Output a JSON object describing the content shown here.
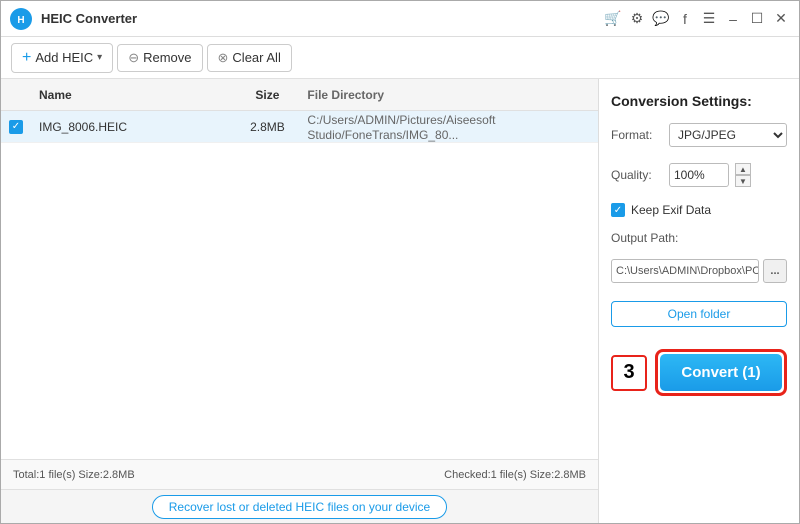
{
  "titlebar": {
    "title": "HEIC Converter",
    "min_label": "–",
    "max_label": "☐",
    "close_label": "✕",
    "icons": [
      "🛒",
      "⚙",
      "💬",
      "f",
      "☰"
    ]
  },
  "toolbar": {
    "add_label": "Add HEIC",
    "remove_label": "Remove",
    "clear_label": "Clear All"
  },
  "table": {
    "col_check": "",
    "col_name": "Name",
    "col_size": "Size",
    "col_dir": "File Directory",
    "rows": [
      {
        "name": "IMG_8006.HEIC",
        "size": "2.8MB",
        "dir": "C:/Users/ADMIN/Pictures/Aiseesoft Studio/FoneTrans/IMG_80..."
      }
    ]
  },
  "panel": {
    "title": "Conversion Settings:",
    "format_label": "Format:",
    "format_value": "JPG/JPEG",
    "quality_label": "Quality:",
    "quality_value": "100%",
    "exif_label": "Keep Exif Data",
    "output_label": "Output Path:",
    "output_path": "C:\\Users\\ADMIN\\Dropbox\\PC\\",
    "browse_label": "...",
    "open_folder_label": "Open folder",
    "step_badge": "3",
    "convert_label": "Convert (1)"
  },
  "statusbar": {
    "left": "Total:1 file(s) Size:2.8MB",
    "right": "Checked:1 file(s) Size:2.8MB"
  },
  "recovery": {
    "label": "Recover lost or deleted HEIC files on your device"
  }
}
